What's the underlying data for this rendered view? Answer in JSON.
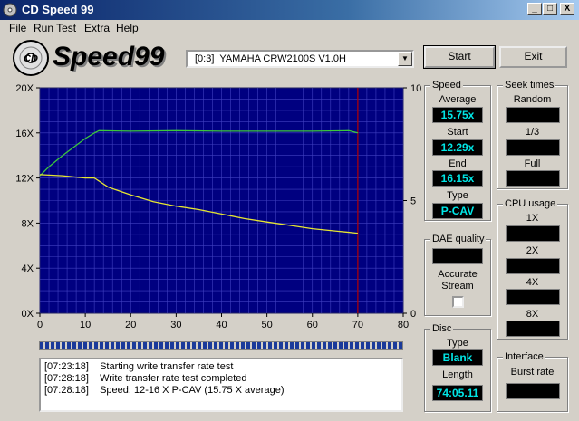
{
  "window": {
    "title": "CD Speed 99",
    "icon": "cd-icon",
    "controls": [
      "_",
      "□",
      "X"
    ]
  },
  "menu": [
    "File",
    "Run Test",
    "Extra",
    "Help"
  ],
  "toolbar": {
    "logo_text": "Speed99",
    "drive": "[0:3]  YAMAHA CRW2100S V1.0H",
    "start_label": "Start",
    "exit_label": "Exit"
  },
  "chart_data": {
    "type": "line",
    "x_ticks": [
      "0",
      "10",
      "20",
      "30",
      "40",
      "50",
      "60",
      "70",
      "80"
    ],
    "y_left_ticks": [
      "0X",
      "4X",
      "8X",
      "12X",
      "16X",
      "20X"
    ],
    "y_right_ticks": [
      "0",
      "5",
      "10"
    ],
    "xlim": [
      0,
      80
    ],
    "ylim": [
      0,
      20
    ],
    "y2lim": [
      0,
      10
    ],
    "marker_x": 70,
    "grid": true,
    "colors": {
      "background": "#000080",
      "grid": "#4040c0",
      "speed": "#3cc83c",
      "cpu": "#e6e632",
      "marker": "#b40000"
    },
    "series": [
      {
        "color_key": "speed",
        "x": [
          0,
          2,
          5,
          8,
          10,
          12,
          13,
          20,
          30,
          40,
          50,
          60,
          68,
          70
        ],
        "y": [
          12.2,
          13.0,
          14.0,
          14.9,
          15.5,
          16.0,
          16.2,
          16.15,
          16.2,
          16.15,
          16.15,
          16.15,
          16.2,
          16.0
        ]
      },
      {
        "color_key": "cpu",
        "x": [
          0,
          5,
          10,
          12,
          15,
          20,
          25,
          30,
          35,
          40,
          45,
          50,
          55,
          60,
          65,
          70
        ],
        "y": [
          12.3,
          12.2,
          12.0,
          12.0,
          11.2,
          10.5,
          9.9,
          9.5,
          9.2,
          8.8,
          8.4,
          8.1,
          7.8,
          7.5,
          7.3,
          7.1
        ]
      }
    ]
  },
  "log": [
    {
      "time": "[07:23:18]",
      "text": "Starting write transfer rate test"
    },
    {
      "time": "[07:28:18]",
      "text": "Write transfer rate test completed"
    },
    {
      "time": "[07:28:18]",
      "text": "Speed: 12-16 X P-CAV (15.75 X average)"
    }
  ],
  "speed": {
    "title": "Speed",
    "average_label": "Average",
    "average": "15.75x",
    "start_label": "Start",
    "start": "12.29x",
    "end_label": "End",
    "end": "16.15x",
    "type_label": "Type",
    "type": "P-CAV"
  },
  "seek": {
    "title": "Seek times",
    "random_label": "Random",
    "third_label": "1/3",
    "full_label": "Full"
  },
  "cpu": {
    "title": "CPU usage",
    "l1": "1X",
    "l2": "2X",
    "l4": "4X",
    "l8": "8X"
  },
  "dae": {
    "title": "DAE quality",
    "accurate_label": "Accurate",
    "stream_label": "Stream"
  },
  "disc": {
    "title": "Disc",
    "type_label": "Type",
    "type": "Blank",
    "length_label": "Length",
    "length": "74:05.11"
  },
  "interface": {
    "title": "Interface",
    "burst_label": "Burst rate"
  }
}
